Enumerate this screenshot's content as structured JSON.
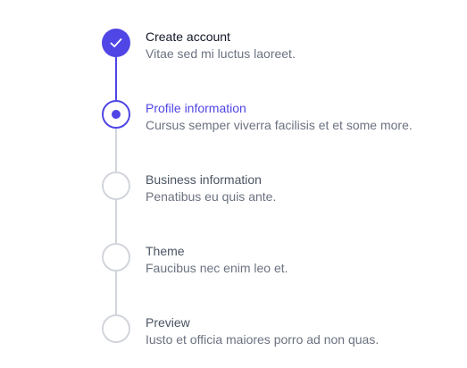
{
  "accent_color": "#4f46e5",
  "steps": [
    {
      "status": "complete",
      "title": "Create account",
      "description": "Vitae sed mi luctus laoreet.",
      "icon": "check-icon"
    },
    {
      "status": "current",
      "title": "Profile information",
      "description": "Cursus semper viverra facilisis et et some more.",
      "icon": "current-dot-icon"
    },
    {
      "status": "upcoming",
      "title": "Business information",
      "description": "Penatibus eu quis ante."
    },
    {
      "status": "upcoming",
      "title": "Theme",
      "description": "Faucibus nec enim leo et."
    },
    {
      "status": "upcoming",
      "title": "Preview",
      "description": "Iusto et officia maiores porro ad non quas."
    }
  ]
}
